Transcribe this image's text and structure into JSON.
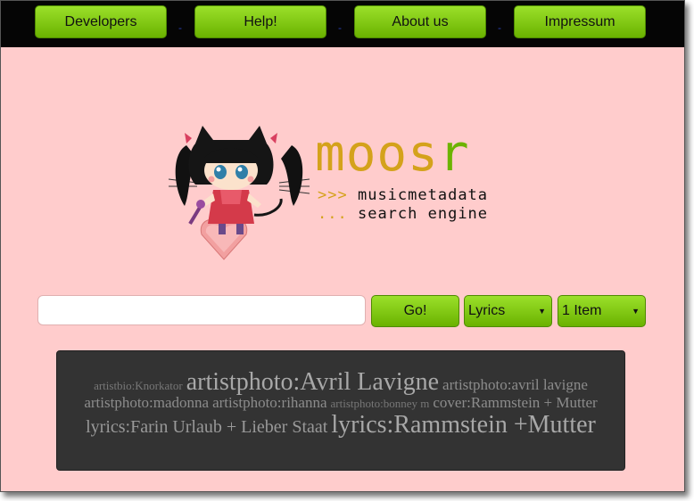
{
  "nav": {
    "items": [
      {
        "label": "Developers"
      },
      {
        "label": "Help!"
      },
      {
        "label": "About us"
      },
      {
        "label": "Impressum"
      }
    ],
    "separator": "-"
  },
  "logo": {
    "name_main": "moos",
    "name_accent": "r",
    "tagline_arrow": ">>>",
    "tagline_line1": "musicmetadata",
    "tagline_dots": "...",
    "tagline_line2": "search engine"
  },
  "search": {
    "value": "",
    "go_label": "Go!",
    "type_select": "Lyrics",
    "count_select": "1 Item"
  },
  "tag_cloud": [
    {
      "text": "artistbio:Knorkator",
      "size": "t1"
    },
    {
      "text": "artistphoto:Avril Lavigne",
      "size": "t4"
    },
    {
      "text": "artistphoto:avril lavigne",
      "size": "t2"
    },
    {
      "text": "artistphoto:madonna",
      "size": "t2"
    },
    {
      "text": "artistphoto:rihanna",
      "size": "t2"
    },
    {
      "text": "artistphoto:bonney m",
      "size": "t1"
    },
    {
      "text": "cover:Rammstein + Mutter",
      "size": "t2"
    },
    {
      "text": "lyrics:Farin Urlaub + Lieber Staat",
      "size": "t3"
    },
    {
      "text": "lyrics:Rammstein +Mutter",
      "size": "t4"
    }
  ],
  "colors": {
    "background": "#ffcccc",
    "navbar": "#050505",
    "button_green": "#7fc61a",
    "logo_gold": "#d4a21b",
    "logo_green": "#6cb300",
    "tag_cloud_bg": "#333333"
  }
}
